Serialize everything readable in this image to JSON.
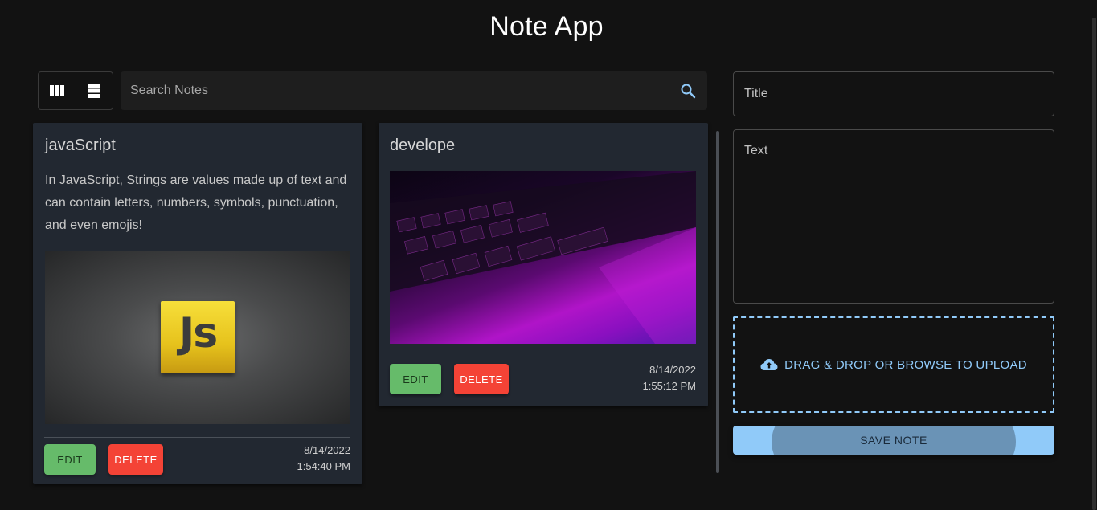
{
  "app": {
    "title": "Note App"
  },
  "toolbar": {
    "view_modes": [
      "grid-view-icon",
      "list-view-icon"
    ],
    "search_placeholder": "Search Notes"
  },
  "notes": [
    {
      "title": "javaScript",
      "text": "In JavaScript, Strings are values made up of text and can contain letters, numbers, symbols, punctuation, and even emojis!",
      "image": "javascript-logo-image",
      "image_text": "Js",
      "edit_label": "EDIT",
      "delete_label": "DELETE",
      "date": "8/14/2022",
      "time": "1:54:40 PM"
    },
    {
      "title": "develope",
      "text": "",
      "image": "keyboard-photo-image",
      "edit_label": "EDIT",
      "delete_label": "DELETE",
      "date": "8/14/2022",
      "time": "1:55:12 PM"
    }
  ],
  "form": {
    "title_placeholder": "Title",
    "text_placeholder": "Text",
    "upload_label": "DRAG & DROP OR BROWSE TO UPLOAD",
    "save_label": "SAVE NOTE"
  },
  "colors": {
    "background": "#121212",
    "card": "#222831",
    "edit": "#66bb6a",
    "delete": "#f44336",
    "accent": "#90caf9"
  }
}
